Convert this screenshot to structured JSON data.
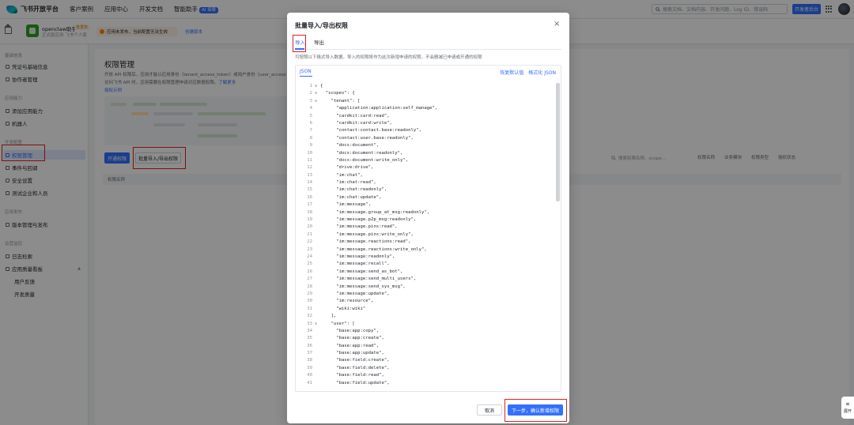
{
  "topbar": {
    "brand": "飞书开放平台",
    "nav": [
      "客户案例",
      "应用中心",
      "开发文档",
      "智能助手"
    ],
    "ai_badge": "AI 探索",
    "search_placeholder": "搜索文档、文档内容、开发问题、Log ID、错误码",
    "console_button": "开发者后台"
  },
  "app": {
    "name": "openclaw助手",
    "status": "未发布",
    "subtitle": "正式版应用 飞书个人版",
    "notice": "应用未发布，当前配置无法生效",
    "release_link": "创建版本"
  },
  "sidebar": {
    "groups": [
      {
        "label": "基础信息",
        "items": [
          {
            "label": "凭证与基础信息"
          },
          {
            "label": "协作者管理"
          }
        ]
      },
      {
        "label": "应用能力",
        "items": [
          {
            "label": "添加应用能力"
          },
          {
            "label": "机器人"
          }
        ]
      },
      {
        "label": "开发配置",
        "items": [
          {
            "label": "权限管理"
          },
          {
            "label": "事件与回调"
          },
          {
            "label": "安全设置"
          },
          {
            "label": "测试企业和人员"
          }
        ]
      },
      {
        "label": "应用发布",
        "items": [
          {
            "label": "版本管理与发布"
          }
        ]
      },
      {
        "label": "运营监控",
        "items": [
          {
            "label": "日志检索"
          },
          {
            "label": "应用质量看板"
          },
          {
            "label": "用户反馈"
          },
          {
            "label": "开发质量"
          }
        ]
      }
    ]
  },
  "main": {
    "title": "权限管理",
    "desc_line1": "开放 API 权限后，应用才能以应用身份（tenant_access_token）或用户身份（user_access",
    "desc_line2": "访问飞书 API 时，应用需要在权限管理申请对应数据权限。",
    "desc_link": "了解更多",
    "example_link": "授权示例",
    "open_button": "开通权限",
    "batch_button": "批量导入/导出权限",
    "filter_search_placeholder": "搜索权限名称、scope...",
    "filters": [
      "权限名称",
      "业务模块",
      "权限类型",
      "授权状态"
    ],
    "table_col": "权限名称"
  },
  "modal": {
    "title": "批量导入/导出权限",
    "close": "×",
    "tabs": [
      "导入",
      "导出"
    ],
    "hint": "可按照以下格式导入数据。导入的权限将作为此次新增申请的权限，不会删减已申请或开通的权限",
    "editor_tab": "JSON",
    "restore_default": "恢复默认值",
    "format_json": "格式化 JSON",
    "code_lines": [
      {
        "n": "1",
        "fold": "v",
        "text": "{"
      },
      {
        "n": "2",
        "fold": "v",
        "text": "  \"scopes\": {"
      },
      {
        "n": "3",
        "fold": "v",
        "text": "    \"tenant\": ["
      },
      {
        "n": "4",
        "fold": "",
        "text": "      \"application:application:self_manage\","
      },
      {
        "n": "5",
        "fold": "",
        "text": "      \"cardkit:card:read\","
      },
      {
        "n": "6",
        "fold": "",
        "text": "      \"cardkit:card:write\","
      },
      {
        "n": "7",
        "fold": "",
        "text": "      \"contact:contact.base:readonly\","
      },
      {
        "n": "8",
        "fold": "",
        "text": "      \"contact:user.base:readonly\","
      },
      {
        "n": "9",
        "fold": "",
        "text": "      \"docs:document\","
      },
      {
        "n": "10",
        "fold": "",
        "text": "      \"docx:document:readonly\","
      },
      {
        "n": "11",
        "fold": "",
        "text": "      \"docx:document:write_only\","
      },
      {
        "n": "12",
        "fold": "",
        "text": "      \"drive:drive\","
      },
      {
        "n": "13",
        "fold": "",
        "text": "      \"im:chat\","
      },
      {
        "n": "14",
        "fold": "",
        "text": "      \"im:chat:read\","
      },
      {
        "n": "15",
        "fold": "",
        "text": "      \"im:chat:readonly\","
      },
      {
        "n": "16",
        "fold": "",
        "text": "      \"im:chat:update\","
      },
      {
        "n": "17",
        "fold": "",
        "text": "      \"im:message\","
      },
      {
        "n": "18",
        "fold": "",
        "text": "      \"im:message.group_at_msg:readonly\","
      },
      {
        "n": "19",
        "fold": "",
        "text": "      \"im:message.p2p_msg:readonly\","
      },
      {
        "n": "20",
        "fold": "",
        "text": "      \"im:message.pins:read\","
      },
      {
        "n": "21",
        "fold": "",
        "text": "      \"im:message.pins:write_only\","
      },
      {
        "n": "22",
        "fold": "",
        "text": "      \"im:message.reactions:read\","
      },
      {
        "n": "23",
        "fold": "",
        "text": "      \"im:message.reactions:write_only\","
      },
      {
        "n": "24",
        "fold": "",
        "text": "      \"im:message:readonly\","
      },
      {
        "n": "25",
        "fold": "",
        "text": "      \"im:message:recall\","
      },
      {
        "n": "26",
        "fold": "",
        "text": "      \"im:message:send_as_bot\","
      },
      {
        "n": "27",
        "fold": "",
        "text": "      \"im:message:send_multi_users\","
      },
      {
        "n": "28",
        "fold": "",
        "text": "      \"im:message:send_sys_msg\","
      },
      {
        "n": "29",
        "fold": "",
        "text": "      \"im:message:update\","
      },
      {
        "n": "30",
        "fold": "",
        "text": "      \"im:resource\","
      },
      {
        "n": "31",
        "fold": "",
        "text": "      \"wiki:wiki\""
      },
      {
        "n": "32",
        "fold": "",
        "text": "    ],"
      },
      {
        "n": "33",
        "fold": "v",
        "text": "    \"user\": ["
      },
      {
        "n": "34",
        "fold": "",
        "text": "      \"base:app:copy\","
      },
      {
        "n": "35",
        "fold": "",
        "text": "      \"base:app:create\","
      },
      {
        "n": "36",
        "fold": "",
        "text": "      \"base:app:read\","
      },
      {
        "n": "37",
        "fold": "",
        "text": "      \"base:app:update\","
      },
      {
        "n": "38",
        "fold": "",
        "text": "      \"base:field:create\","
      },
      {
        "n": "39",
        "fold": "",
        "text": "      \"base:field:delete\","
      },
      {
        "n": "40",
        "fold": "",
        "text": "      \"base:field:read\","
      },
      {
        "n": "41",
        "fold": "",
        "text": "      \"base:field:update\","
      }
    ],
    "cancel_button": "取消",
    "next_button": "下一步，确认新增权限"
  },
  "side_tool": {
    "label": "展开"
  },
  "colors": {
    "accent": "#3370ff",
    "highlight": "#e02020"
  }
}
